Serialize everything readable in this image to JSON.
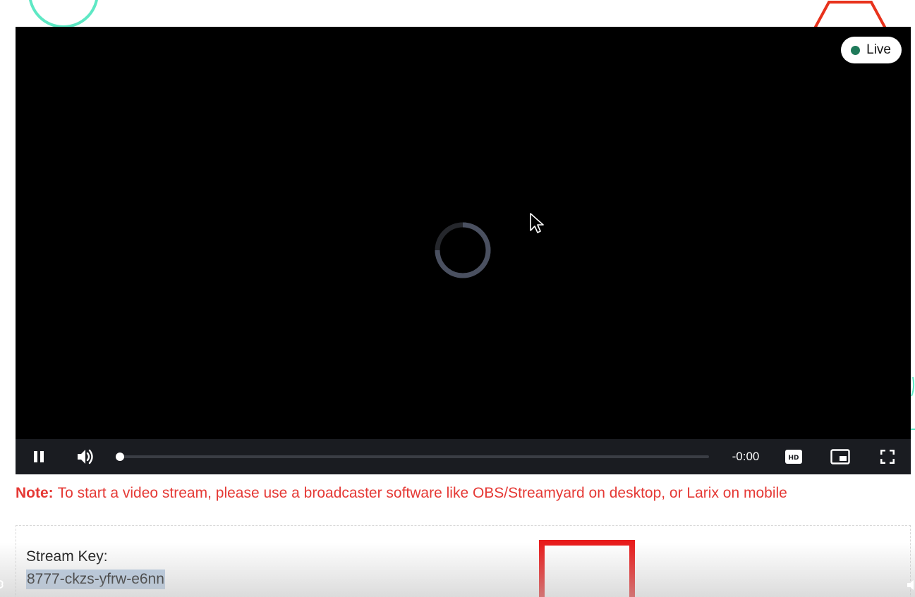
{
  "player": {
    "live_label": "Live",
    "time_remaining": "-0:00",
    "progress_fraction": 0.0,
    "colors": {
      "live_dot": "#1f7a5a",
      "control_bar": "#1a1c21"
    },
    "controls": {
      "play_state_icon": "pause-icon",
      "volume_icon": "volume-icon",
      "quality_icon": "hd-icon",
      "pip_icon": "picture-in-picture-icon",
      "fullscreen_icon": "fullscreen-icon"
    },
    "quality_badge": "HD"
  },
  "note": {
    "label": "Note:",
    "text": "To start a video stream, please use a broadcaster software like OBS/Streamyard on desktop, or Larix on mobile",
    "color": "#e53935"
  },
  "stream": {
    "key_label": "Stream Key:",
    "key_value": "8777-ckzs-yfrw-e6nn"
  }
}
